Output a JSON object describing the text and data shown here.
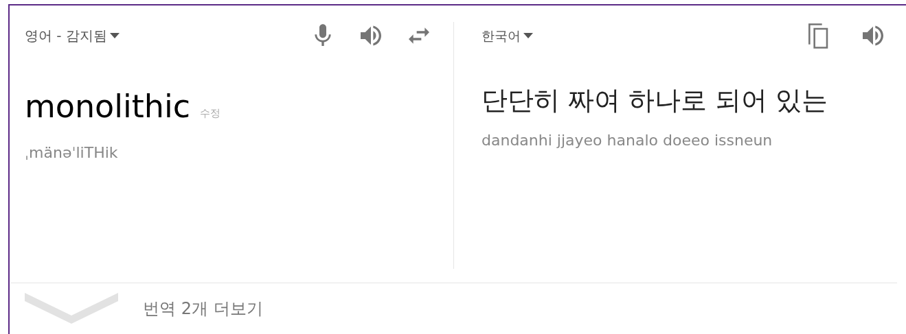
{
  "source": {
    "language": "영어 - 감지됨",
    "word": "monolithic",
    "edit_label": "수정",
    "pronunciation": "ˌmänəˈliTHik"
  },
  "target": {
    "language": "한국어",
    "translation": "단단히 짜여 하나로 되어 있는",
    "romanization": "dandanhi jjayeo hanalo doeeo issneun"
  },
  "more_translations": "번역 2개 더보기"
}
